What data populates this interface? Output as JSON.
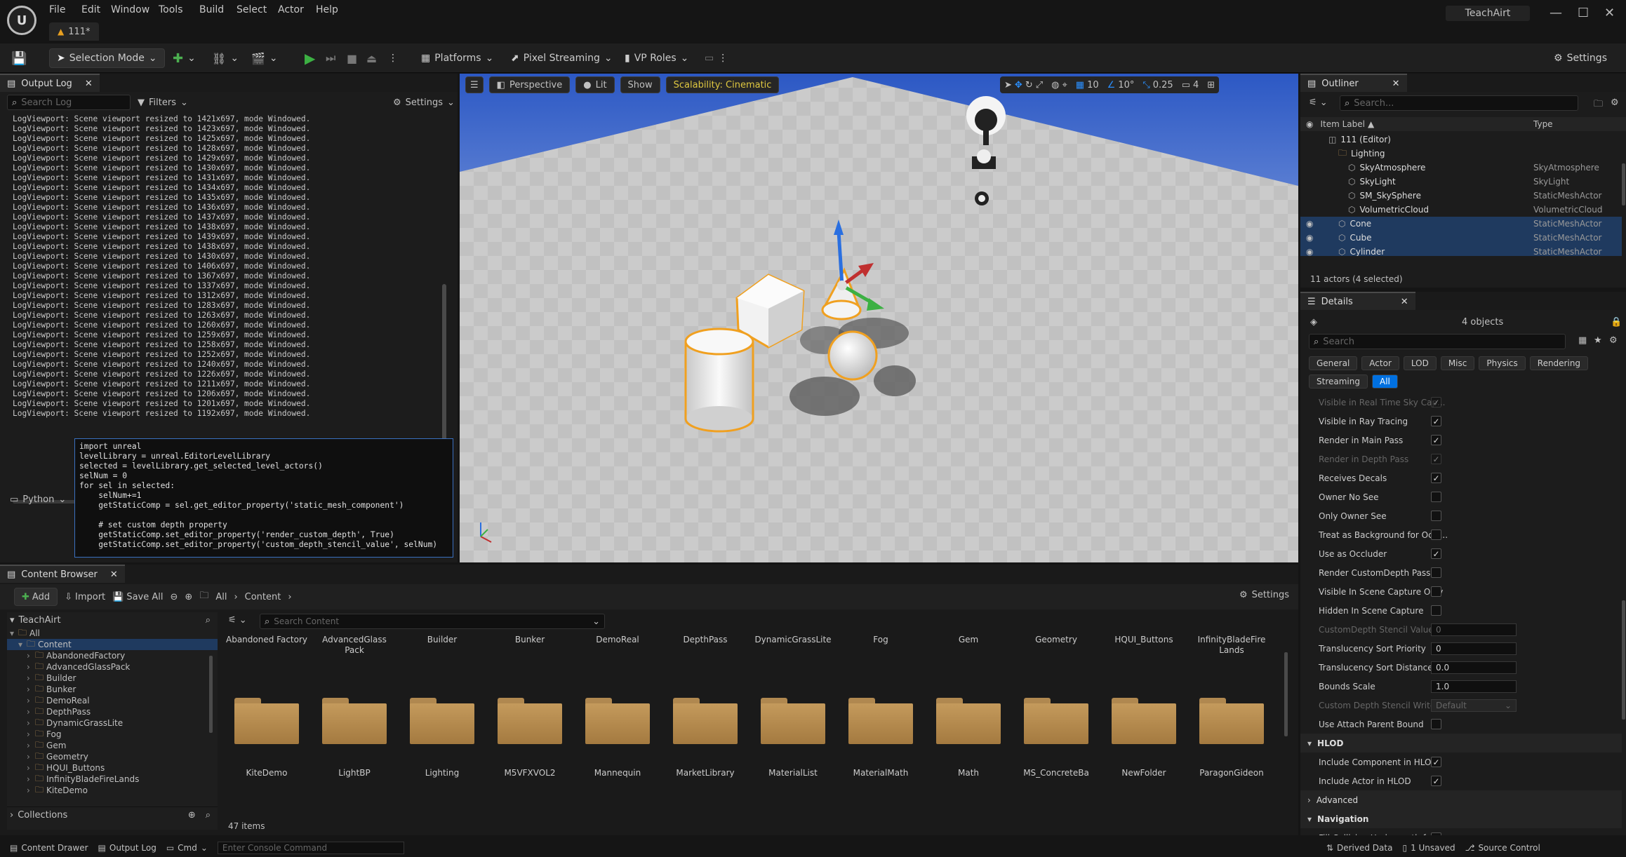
{
  "app": {
    "logo": "unreal-logo",
    "project_tab": "111*",
    "project_name": "TeachAirt",
    "menu": [
      "File",
      "Edit",
      "Window",
      "Tools",
      "Build",
      "Select",
      "Actor",
      "Help"
    ]
  },
  "toolbar": {
    "selection_mode": "Selection Mode",
    "platforms": "Platforms",
    "pixel_streaming": "Pixel Streaming",
    "vp_roles": "VP Roles",
    "settings": "Settings"
  },
  "output_log": {
    "tab_label": "Output Log",
    "search_placeholder": "Search Log",
    "filters_label": "Filters",
    "settings_label": "Settings",
    "lines": [
      "LogViewport: Scene viewport resized to 1421x697, mode Windowed.",
      "LogViewport: Scene viewport resized to 1423x697, mode Windowed.",
      "LogViewport: Scene viewport resized to 1425x697, mode Windowed.",
      "LogViewport: Scene viewport resized to 1428x697, mode Windowed.",
      "LogViewport: Scene viewport resized to 1429x697, mode Windowed.",
      "LogViewport: Scene viewport resized to 1430x697, mode Windowed.",
      "LogViewport: Scene viewport resized to 1431x697, mode Windowed.",
      "LogViewport: Scene viewport resized to 1434x697, mode Windowed.",
      "LogViewport: Scene viewport resized to 1435x697, mode Windowed.",
      "LogViewport: Scene viewport resized to 1436x697, mode Windowed.",
      "LogViewport: Scene viewport resized to 1437x697, mode Windowed.",
      "LogViewport: Scene viewport resized to 1438x697, mode Windowed.",
      "LogViewport: Scene viewport resized to 1439x697, mode Windowed.",
      "LogViewport: Scene viewport resized to 1438x697, mode Windowed.",
      "LogViewport: Scene viewport resized to 1430x697, mode Windowed.",
      "LogViewport: Scene viewport resized to 1406x697, mode Windowed.",
      "LogViewport: Scene viewport resized to 1367x697, mode Windowed.",
      "LogViewport: Scene viewport resized to 1337x697, mode Windowed.",
      "LogViewport: Scene viewport resized to 1312x697, mode Windowed.",
      "LogViewport: Scene viewport resized to 1283x697, mode Windowed.",
      "LogViewport: Scene viewport resized to 1263x697, mode Windowed.",
      "LogViewport: Scene viewport resized to 1260x697, mode Windowed.",
      "LogViewport: Scene viewport resized to 1259x697, mode Windowed.",
      "LogViewport: Scene viewport resized to 1258x697, mode Windowed.",
      "LogViewport: Scene viewport resized to 1252x697, mode Windowed.",
      "LogViewport: Scene viewport resized to 1240x697, mode Windowed.",
      "LogViewport: Scene viewport resized to 1226x697, mode Windowed.",
      "LogViewport: Scene viewport resized to 1211x697, mode Windowed.",
      "LogViewport: Scene viewport resized to 1206x697, mode Windowed.",
      "LogViewport: Scene viewport resized to 1201x697, mode Windowed.",
      "LogViewport: Scene viewport resized to 1192x697, mode Windowed."
    ],
    "python_label": "Python",
    "code": [
      "import unreal",
      "levelLibrary = unreal.EditorLevelLibrary",
      "selected = levelLibrary.get_selected_level_actors()",
      "selNum = 0",
      "for sel in selected:",
      "    selNum+=1",
      "    getStaticComp = sel.get_editor_property('static_mesh_component')",
      "",
      "    # set custom depth property",
      "    getStaticComp.set_editor_property('render_custom_depth', True)",
      "    getStaticComp.set_editor_property('custom_depth_stencil_value', selNum)"
    ]
  },
  "viewport": {
    "perspective": "Perspective",
    "lit": "Lit",
    "show": "Show",
    "scalability": "Scalability: Cinematic",
    "grid_snap": "10",
    "rot_snap": "10°",
    "scale_snap": "0.25",
    "camera_speed": "4"
  },
  "outliner": {
    "tab_label": "Outliner",
    "search_placeholder": "Search...",
    "col_label": "Item Label",
    "col_type": "Type",
    "rows": [
      {
        "label": "111 (Editor)",
        "type": "",
        "indent": 0,
        "selected": false
      },
      {
        "label": "Lighting",
        "type": "",
        "indent": 1,
        "selected": false
      },
      {
        "label": "SkyAtmosphere",
        "type": "SkyAtmosphere",
        "indent": 2,
        "selected": false
      },
      {
        "label": "SkyLight",
        "type": "SkyLight",
        "indent": 2,
        "selected": false
      },
      {
        "label": "SM_SkySphere",
        "type": "StaticMeshActor",
        "indent": 2,
        "selected": false
      },
      {
        "label": "VolumetricCloud",
        "type": "VolumetricCloud",
        "indent": 2,
        "selected": false
      },
      {
        "label": "Cone",
        "type": "StaticMeshActor",
        "indent": 1,
        "selected": true
      },
      {
        "label": "Cube",
        "type": "StaticMeshActor",
        "indent": 1,
        "selected": true
      },
      {
        "label": "Cylinder",
        "type": "StaticMeshActor",
        "indent": 1,
        "selected": true
      }
    ],
    "status": "11 actors (4 selected)"
  },
  "details": {
    "tab_label": "Details",
    "objects": "4 objects",
    "search_placeholder": "Search",
    "categories": [
      "General",
      "Actor",
      "LOD",
      "Misc",
      "Physics",
      "Rendering",
      "Streaming",
      "All"
    ],
    "active_category": "All",
    "props": [
      {
        "label": "Visible in Real Time Sky Cap...",
        "kind": "check",
        "checked": true,
        "dim": true
      },
      {
        "label": "Visible in Ray Tracing",
        "kind": "check",
        "checked": true
      },
      {
        "label": "Render in Main Pass",
        "kind": "check",
        "checked": true
      },
      {
        "label": "Render in Depth Pass",
        "kind": "check",
        "checked": true,
        "dim": true
      },
      {
        "label": "Receives Decals",
        "kind": "check",
        "checked": true
      },
      {
        "label": "Owner No See",
        "kind": "check",
        "checked": false
      },
      {
        "label": "Only Owner See",
        "kind": "check",
        "checked": false
      },
      {
        "label": "Treat as Background for Occl...",
        "kind": "check",
        "checked": false
      },
      {
        "label": "Use as Occluder",
        "kind": "check",
        "checked": true
      },
      {
        "label": "Render CustomDepth Pass",
        "kind": "check",
        "checked": false
      },
      {
        "label": "Visible In Scene Capture Only",
        "kind": "check",
        "checked": false
      },
      {
        "label": "Hidden In Scene Capture",
        "kind": "check",
        "checked": false
      },
      {
        "label": "CustomDepth Stencil Value",
        "kind": "field",
        "value": "0",
        "dim": true
      },
      {
        "label": "Translucency Sort Priority",
        "kind": "field",
        "value": "0"
      },
      {
        "label": "Translucency Sort Distance...",
        "kind": "field",
        "value": "0.0"
      },
      {
        "label": "Bounds Scale",
        "kind": "field",
        "value": "1.0"
      },
      {
        "label": "Custom Depth Stencil Write...",
        "kind": "select",
        "value": "Default",
        "dim": true
      },
      {
        "label": "Use Attach Parent Bound",
        "kind": "check",
        "checked": false
      },
      {
        "label": "HLOD",
        "kind": "section"
      },
      {
        "label": "Include Component in HLOD",
        "kind": "check",
        "checked": true
      },
      {
        "label": "Include Actor in HLOD",
        "kind": "check",
        "checked": true
      },
      {
        "label": "Advanced",
        "kind": "collapsed"
      },
      {
        "label": "Navigation",
        "kind": "section"
      },
      {
        "label": "Fill Collision Underneath for...",
        "kind": "check",
        "checked": false
      }
    ]
  },
  "content_browser": {
    "tab_label": "Content Browser",
    "add": "Add",
    "import": "Import",
    "save_all": "Save All",
    "path": [
      "All",
      "Content"
    ],
    "settings": "Settings",
    "project": "TeachAirt",
    "tree": [
      {
        "label": "All",
        "indent": 0,
        "selected": false
      },
      {
        "label": "Content",
        "indent": 1,
        "selected": true
      },
      {
        "label": "AbandonedFactory",
        "indent": 2,
        "selected": false
      },
      {
        "label": "AdvancedGlassPack",
        "indent": 2,
        "selected": false
      },
      {
        "label": "Builder",
        "indent": 2,
        "selected": false
      },
      {
        "label": "Bunker",
        "indent": 2,
        "selected": false
      },
      {
        "label": "DemoReal",
        "indent": 2,
        "selected": false
      },
      {
        "label": "DepthPass",
        "indent": 2,
        "selected": false
      },
      {
        "label": "DynamicGrassLite",
        "indent": 2,
        "selected": false
      },
      {
        "label": "Fog",
        "indent": 2,
        "selected": false
      },
      {
        "label": "Gem",
        "indent": 2,
        "selected": false
      },
      {
        "label": "Geometry",
        "indent": 2,
        "selected": false
      },
      {
        "label": "HQUI_Buttons",
        "indent": 2,
        "selected": false
      },
      {
        "label": "InfinityBladeFireLands",
        "indent": 2,
        "selected": false
      },
      {
        "label": "KiteDemo",
        "indent": 2,
        "selected": false
      }
    ],
    "collections": "Collections",
    "search_placeholder": "Search Content",
    "top_labels": [
      "Abandoned Factory",
      "AdvancedGlass Pack",
      "Builder",
      "Bunker",
      "DemoReal",
      "DepthPass",
      "DynamicGrassLite",
      "Fog",
      "Gem",
      "Geometry",
      "HQUI_Buttons",
      "InfinityBladeFire Lands"
    ],
    "folders": [
      "KiteDemo",
      "LightBP",
      "Lighting",
      "M5VFXVOL2",
      "Mannequin",
      "MarketLibrary",
      "MaterialList",
      "MaterialMath",
      "Math",
      "MS_ConcreteBa",
      "NewFolder",
      "ParagonGideon"
    ],
    "count": "47 items"
  },
  "statusbar": {
    "content_drawer": "Content Drawer",
    "output_log": "Output Log",
    "cmd": "Cmd",
    "console_placeholder": "Enter Console Command",
    "derived_data": "Derived Data",
    "unsaved": "1 Unsaved",
    "source_control": "Source Control"
  },
  "colors": {
    "accent_blue": "#0070e0",
    "selection_orange": "#f0a020",
    "scalability_yellow": "#d8c030",
    "play_green": "#3cb043"
  }
}
